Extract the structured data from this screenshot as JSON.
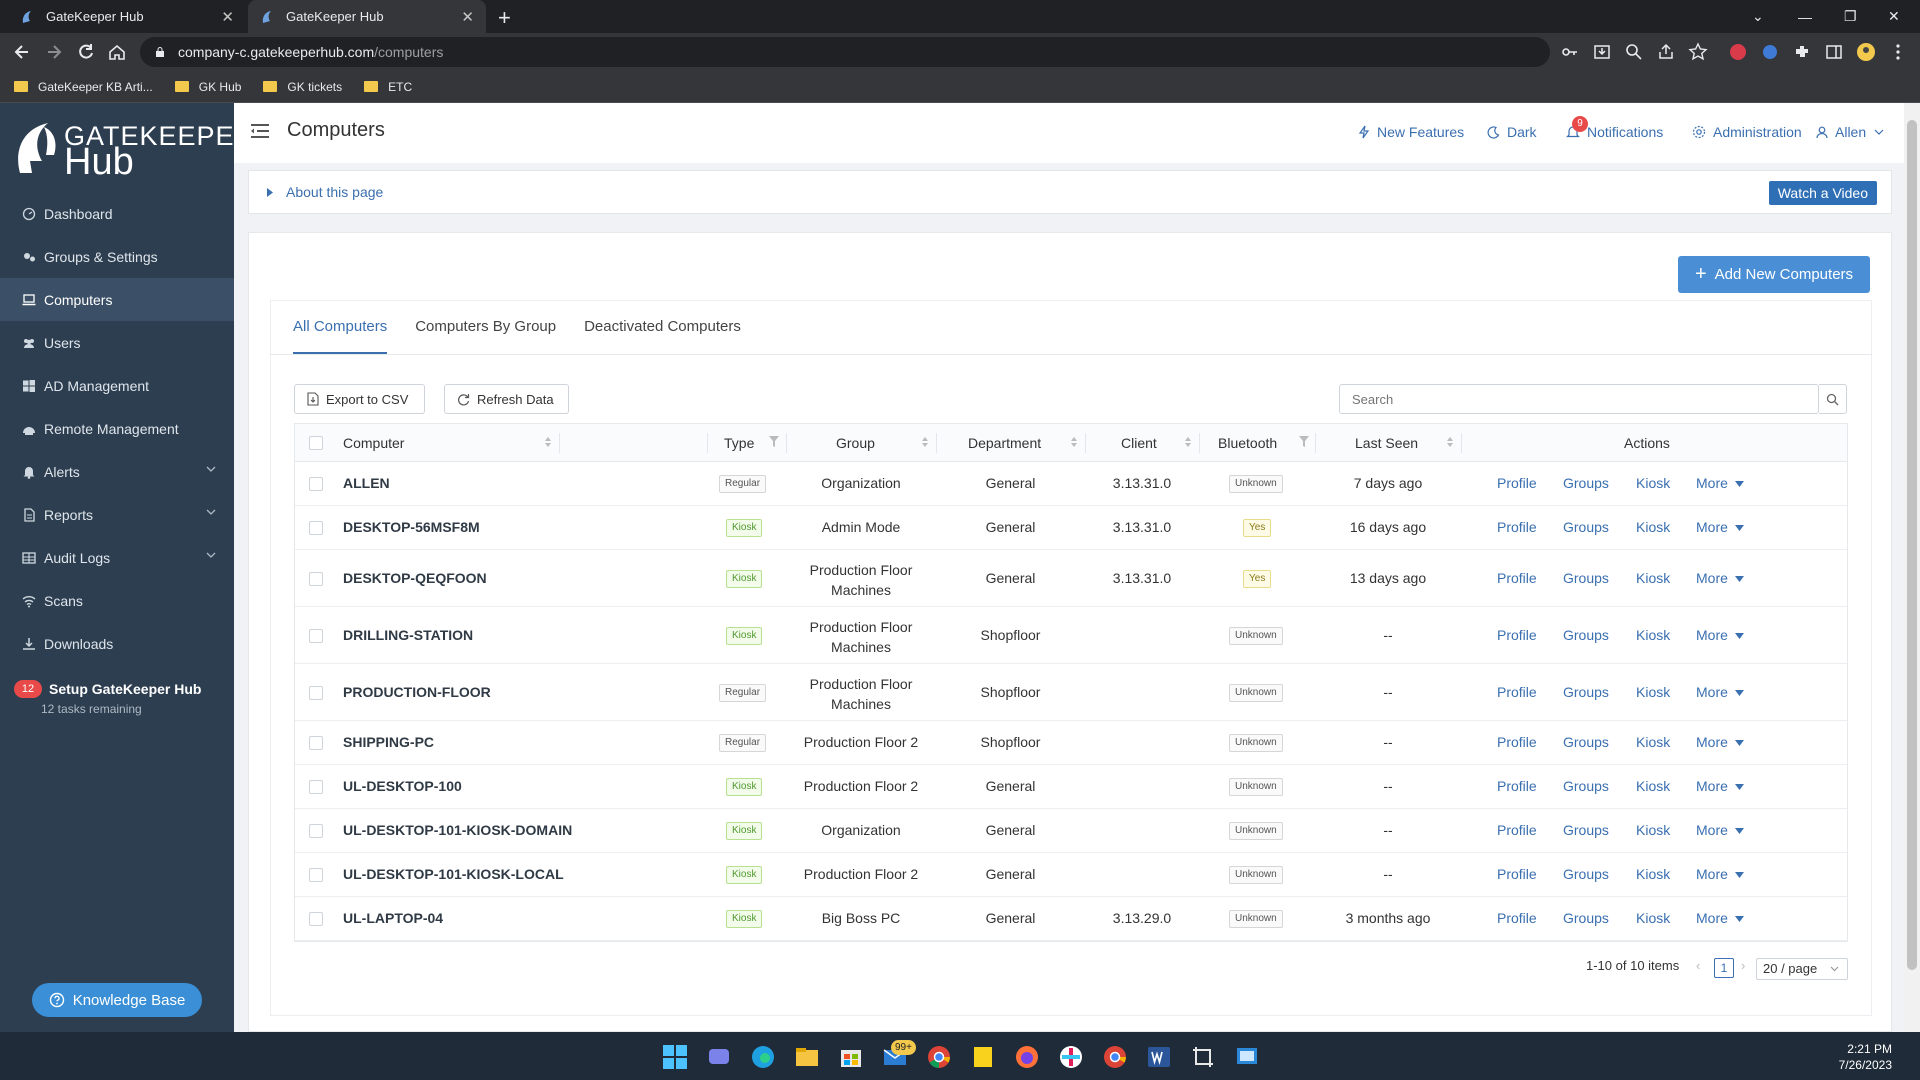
{
  "browser": {
    "tabs": [
      {
        "title": "GateKeeper Hub"
      },
      {
        "title": "GateKeeper Hub"
      }
    ],
    "url_host": "company-c.gatekeeperhub.com",
    "url_path": "/computers",
    "bookmarks": [
      "GateKeeper KB Arti...",
      "GK Hub",
      "GK tickets",
      "ETC"
    ]
  },
  "sidebar": {
    "logo_line1": "GATEKEEPER",
    "logo_line2": "Hub",
    "items": [
      {
        "label": "Dashboard",
        "icon": "dashboard-icon"
      },
      {
        "label": "Groups & Settings",
        "icon": "groups-settings-icon"
      },
      {
        "label": "Computers",
        "icon": "computer-icon",
        "active": true
      },
      {
        "label": "Users",
        "icon": "users-icon"
      },
      {
        "label": "AD Management",
        "icon": "windows-icon"
      },
      {
        "label": "Remote Management",
        "icon": "remote-icon"
      },
      {
        "label": "Alerts",
        "icon": "bell-icon",
        "expandable": true
      },
      {
        "label": "Reports",
        "icon": "report-icon",
        "expandable": true
      },
      {
        "label": "Audit Logs",
        "icon": "table-icon",
        "expandable": true
      },
      {
        "label": "Scans",
        "icon": "wifi-icon"
      },
      {
        "label": "Downloads",
        "icon": "download-icon"
      }
    ],
    "setup": {
      "badge": "12",
      "title": "Setup GateKeeper Hub",
      "subtitle": "12 tasks remaining"
    },
    "knowledge_base": "Knowledge Base"
  },
  "header": {
    "page_title": "Computers",
    "links": {
      "new_features": "New Features",
      "dark": "Dark",
      "notifications": "Notifications",
      "administration": "Administration",
      "user": "Allen"
    },
    "notif_count": "9"
  },
  "about": {
    "label": "About this page",
    "watch_video": "Watch a Video"
  },
  "add_button": "Add New Computers",
  "tabs": [
    "All Computers",
    "Computers By Group",
    "Deactivated Computers"
  ],
  "actions": {
    "export": "Export to CSV",
    "refresh": "Refresh Data",
    "search_placeholder": "Search"
  },
  "table": {
    "headers": {
      "computer": "Computer",
      "type": "Type",
      "group": "Group",
      "department": "Department",
      "client": "Client",
      "bluetooth": "Bluetooth",
      "last_seen": "Last Seen",
      "actions": "Actions"
    },
    "action_labels": {
      "profile": "Profile",
      "groups": "Groups",
      "kiosk": "Kiosk",
      "more": "More"
    },
    "rows": [
      {
        "computer": "ALLEN",
        "type": "Regular",
        "group": [
          "Organization"
        ],
        "department": "General",
        "client": "3.13.31.0",
        "bluetooth": "Unknown",
        "last_seen": "7 days ago"
      },
      {
        "computer": "DESKTOP-56MSF8M",
        "type": "Kiosk",
        "group": [
          "Admin Mode"
        ],
        "department": "General",
        "client": "3.13.31.0",
        "bluetooth": "Yes",
        "last_seen": "16 days ago"
      },
      {
        "computer": "DESKTOP-QEQFOON",
        "type": "Kiosk",
        "group": [
          "Production Floor",
          "Machines"
        ],
        "department": "General",
        "client": "3.13.31.0",
        "bluetooth": "Yes",
        "last_seen": "13 days ago"
      },
      {
        "computer": "DRILLING-STATION",
        "type": "Kiosk",
        "group": [
          "Production Floor",
          "Machines"
        ],
        "department": "Shopfloor",
        "client": "",
        "bluetooth": "Unknown",
        "last_seen": "--"
      },
      {
        "computer": "PRODUCTION-FLOOR",
        "type": "Regular",
        "group": [
          "Production Floor",
          "Machines"
        ],
        "department": "Shopfloor",
        "client": "",
        "bluetooth": "Unknown",
        "last_seen": "--"
      },
      {
        "computer": "SHIPPING-PC",
        "type": "Regular",
        "group": [
          "Production Floor 2"
        ],
        "department": "Shopfloor",
        "client": "",
        "bluetooth": "Unknown",
        "last_seen": "--"
      },
      {
        "computer": "UL-DESKTOP-100",
        "type": "Kiosk",
        "group": [
          "Production Floor 2"
        ],
        "department": "General",
        "client": "",
        "bluetooth": "Unknown",
        "last_seen": "--"
      },
      {
        "computer": "UL-DESKTOP-101-KIOSK-DOMAIN",
        "type": "Kiosk",
        "group": [
          "Organization"
        ],
        "department": "General",
        "client": "",
        "bluetooth": "Unknown",
        "last_seen": "--"
      },
      {
        "computer": "UL-DESKTOP-101-KIOSK-LOCAL",
        "type": "Kiosk",
        "group": [
          "Production Floor 2"
        ],
        "department": "General",
        "client": "",
        "bluetooth": "Unknown",
        "last_seen": "--"
      },
      {
        "computer": "UL-LAPTOP-04",
        "type": "Kiosk",
        "group": [
          "Big Boss PC"
        ],
        "department": "General",
        "client": "3.13.29.0",
        "bluetooth": "Unknown",
        "last_seen": "3 months ago"
      }
    ]
  },
  "pagination": {
    "summary": "1-10 of 10 items",
    "current_page": "1",
    "page_size": "20 / page"
  },
  "taskbar": {
    "mail_badge": "99+",
    "time": "2:21 PM",
    "date": "7/26/2023"
  },
  "colors": {
    "sidebar": "#2d3e50",
    "accent": "#3a6fb0",
    "primary_button": "#4a8fd6",
    "kiosk_tag": "#4f9a2e",
    "badge": "#e84a4a"
  }
}
